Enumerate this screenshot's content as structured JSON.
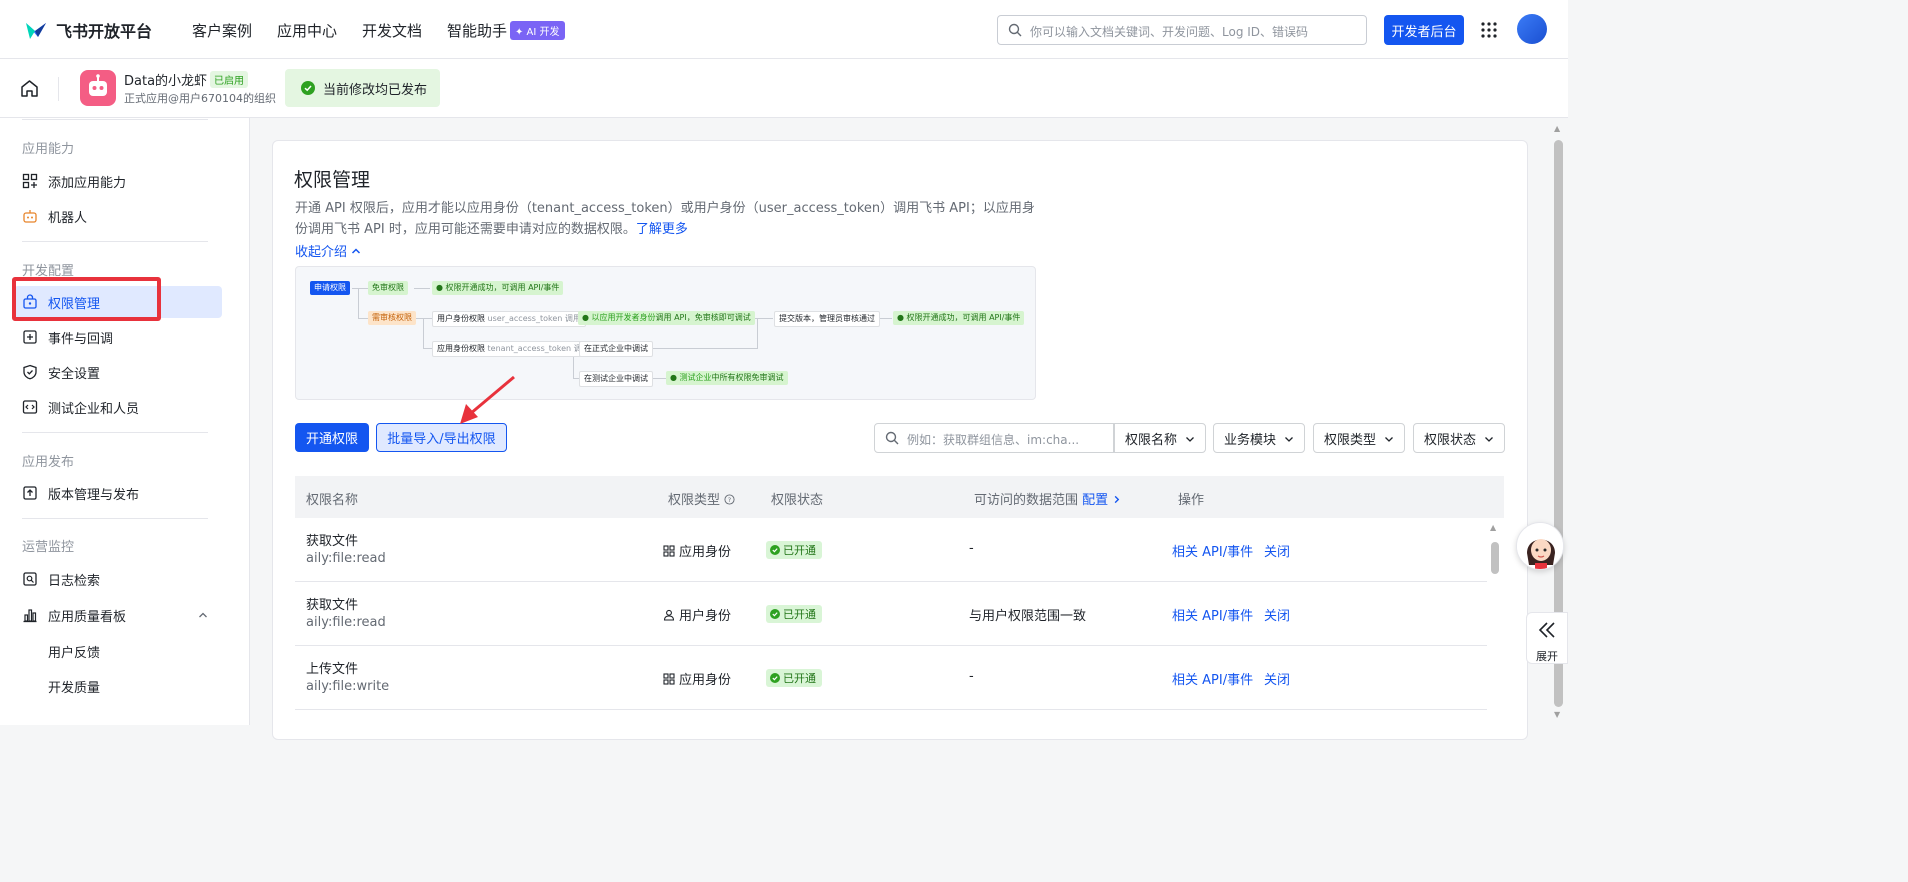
{
  "topnav": {
    "logo_text": "飞书开放平台",
    "items": [
      "客户案例",
      "应用中心",
      "开发文档",
      "智能助手"
    ],
    "ai_badge": "✦ AI 开发",
    "search_placeholder": "你可以输入文档关键词、开发问题、Log ID、错误码",
    "dev_console": "开发者后台"
  },
  "appbar": {
    "app_name": "Data的小龙虾",
    "app_status": "已启用",
    "app_org": "正式应用@用户670104的组织",
    "publish_status": "当前修改均已发布"
  },
  "sidebar": {
    "sections": [
      {
        "title": "应用能力",
        "items": [
          "添加应用能力",
          "机器人"
        ]
      },
      {
        "title": "开发配置",
        "items": [
          "权限管理",
          "事件与回调",
          "安全设置",
          "测试企业和人员"
        ]
      },
      {
        "title": "应用发布",
        "items": [
          "版本管理与发布"
        ]
      },
      {
        "title": "运营监控",
        "items": [
          "日志检索",
          "应用质量看板"
        ]
      }
    ],
    "sub_items": [
      "用户反馈",
      "开发质量"
    ],
    "active_item": "权限管理"
  },
  "main": {
    "title": "权限管理",
    "desc": "开通 API 权限后，应用才能以应用身份（tenant_access_token）或用户身份（user_access_token）调用飞书 API；以应用身份调用飞书 API 时，应用可能还需要申请对应的数据权限。",
    "learn_more": "了解更多",
    "collapse": "收起介绍",
    "flow": {
      "apply": "申请权限",
      "free": "免审权限",
      "free_result": "权限开通成功，可调用 API/事件",
      "need": "需审核权限",
      "user_auth": "用户身份权限",
      "user_token": "user_access_token 调用",
      "user_result_a": "以应用开发者身份",
      "user_result_b": "调用 API，免审核即可调试",
      "submit": "提交版本，管理员审核通过",
      "final_result": "权限开通成功，可调用 API/事件",
      "app_auth": "应用身份权限",
      "app_token": "tenant_access_token 调用",
      "prod_debug": "在正式企业中调试",
      "test_debug": "在测试企业中调试",
      "test_result_a": "测试企业",
      "test_result_b": "中所有权限免审调试"
    },
    "toolbar": {
      "enable_btn": "开通权限",
      "batch_btn": "批量导入/导出权限",
      "search_placeholder": "例如：获取群组信息、im:cha...",
      "filters": [
        "权限名称",
        "业务模块",
        "权限类型",
        "权限状态"
      ]
    },
    "table": {
      "headers": [
        "权限名称",
        "权限类型",
        "权限状态",
        "可访问的数据范围",
        "配置",
        "操作"
      ],
      "rows": [
        {
          "name": "获取文件",
          "code": "aily:file:read",
          "type": "应用身份",
          "type_icon": "grid-icon",
          "status": "已开通",
          "scope": "-",
          "act1": "相关 API/事件",
          "act2": "关闭"
        },
        {
          "name": "获取文件",
          "code": "aily:file:read",
          "type": "用户身份",
          "type_icon": "user-icon",
          "status": "已开通",
          "scope": "与用户权限范围一致",
          "act1": "相关 API/事件",
          "act2": "关闭"
        },
        {
          "name": "上传文件",
          "code": "aily:file:write",
          "type": "应用身份",
          "type_icon": "grid-icon",
          "status": "已开通",
          "scope": "-",
          "act1": "相关 API/事件",
          "act2": "关闭"
        }
      ]
    }
  },
  "right_panel": {
    "expand_label": "展开"
  },
  "colors": {
    "primary": "#1456f0",
    "success": "#2ea121",
    "highlight": "#e8323c"
  }
}
